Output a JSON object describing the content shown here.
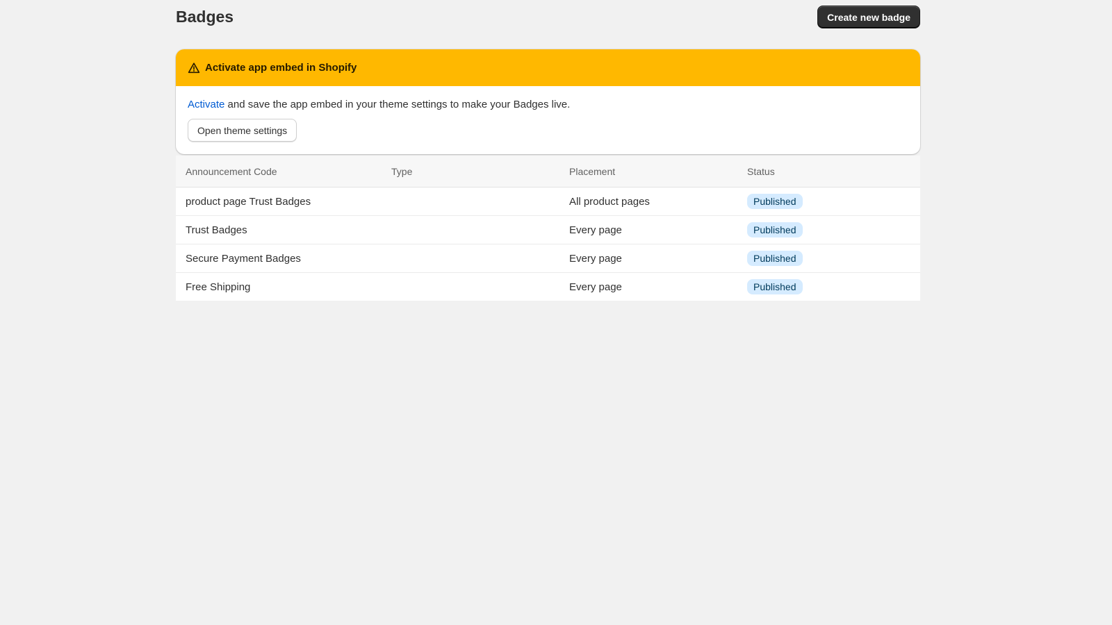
{
  "header": {
    "title": "Badges",
    "create_button": "Create new badge"
  },
  "banner": {
    "title": "Activate app embed in Shopify",
    "link_text": "Activate",
    "message": " and save the app embed in your theme settings to make your Badges live.",
    "button": "Open theme settings",
    "icon": "alert-triangle-icon",
    "color": "#ffb800"
  },
  "table": {
    "columns": [
      "Announcement Code",
      "Type",
      "Placement",
      "Status"
    ],
    "rows": [
      {
        "code": "product page Trust Badges",
        "type": "",
        "placement": "All product pages",
        "status": "Published"
      },
      {
        "code": "Trust Badges",
        "type": "",
        "placement": "Every page",
        "status": "Published"
      },
      {
        "code": "Secure Payment Badges",
        "type": "",
        "placement": "Every page",
        "status": "Published"
      },
      {
        "code": "Free Shipping",
        "type": "",
        "placement": "Every page",
        "status": "Published"
      }
    ]
  },
  "colors": {
    "primary_button": "#303030",
    "link": "#005bd3",
    "status_badge_bg": "#d5ebff"
  }
}
